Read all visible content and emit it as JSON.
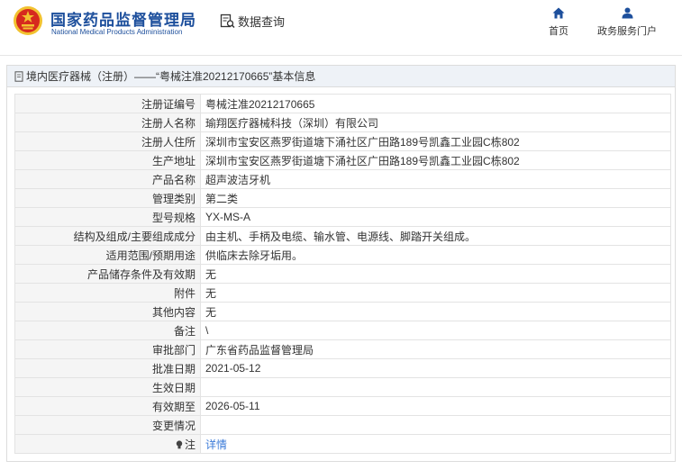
{
  "header": {
    "brand_cn": "国家药品监督管理局",
    "brand_en": "National Medical Products Administration",
    "query_label": "数据查询",
    "nav": [
      {
        "label": "首页",
        "icon": "home-icon"
      },
      {
        "label": "政务服务门户",
        "icon": "user-icon"
      }
    ]
  },
  "panel": {
    "title": "境内医疗器械（注册）——“粤械注准20212170665”基本信息"
  },
  "fields": [
    {
      "label": "注册证编号",
      "value": "粤械注准20212170665"
    },
    {
      "label": "注册人名称",
      "value": "瑜翔医疗器械科技（深圳）有限公司"
    },
    {
      "label": "注册人住所",
      "value": "深圳市宝安区燕罗街道塘下涌社区广田路189号凯鑫工业园C栋802"
    },
    {
      "label": "生产地址",
      "value": "深圳市宝安区燕罗街道塘下涌社区广田路189号凯鑫工业园C栋802"
    },
    {
      "label": "产品名称",
      "value": "超声波洁牙机"
    },
    {
      "label": "管理类别",
      "value": "第二类"
    },
    {
      "label": "型号规格",
      "value": "YX-MS-A"
    },
    {
      "label": "结构及组成/主要组成成分",
      "value": "由主机、手柄及电缆、输水管、电源线、脚踏开关组成。"
    },
    {
      "label": "适用范围/预期用途",
      "value": "供临床去除牙垢用。"
    },
    {
      "label": "产品储存条件及有效期",
      "value": "无"
    },
    {
      "label": "附件",
      "value": "无"
    },
    {
      "label": "其他内容",
      "value": "无"
    },
    {
      "label": "备注",
      "value": "\\"
    },
    {
      "label": "审批部门",
      "value": "广东省药品监督管理局"
    },
    {
      "label": "批准日期",
      "value": "2021-05-12"
    },
    {
      "label": "生效日期",
      "value": ""
    },
    {
      "label": "有效期至",
      "value": "2026-05-11"
    },
    {
      "label": "变更情况",
      "value": ""
    }
  ],
  "note": {
    "label": "注",
    "link": "详情"
  },
  "colors": {
    "brand": "#1d4f9c",
    "link": "#3b7bd8",
    "emblem_red": "#d62a1e",
    "emblem_gold": "#f2c230"
  }
}
